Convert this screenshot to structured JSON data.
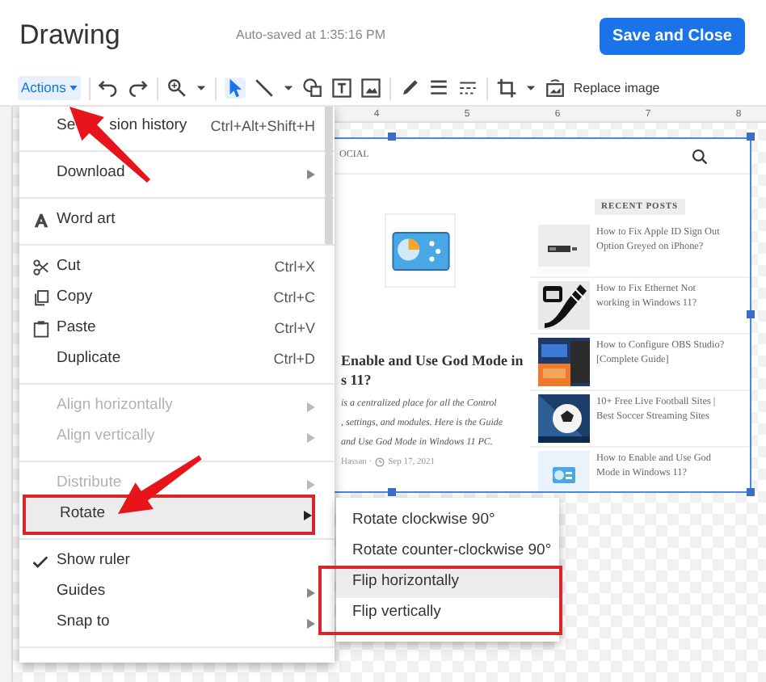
{
  "header": {
    "title": "Drawing",
    "autosave": "Auto-saved at 1:35:16 PM",
    "save_button": "Save and Close"
  },
  "toolbar": {
    "actions": "Actions",
    "replace_image": "Replace image"
  },
  "ruler": {
    "numbers": [
      "4",
      "5",
      "6",
      "7",
      "8"
    ]
  },
  "menu": {
    "groups": [
      [
        {
          "label": "Se",
          "label_after_arrow": "sion history",
          "shortcut": "Ctrl+Alt+Shift+H",
          "submenu": false,
          "disabled": false,
          "selected": false,
          "checked": false
        }
      ],
      [
        {
          "label": "Download",
          "submenu": true,
          "disabled": false,
          "selected": false,
          "checked": false
        }
      ],
      [
        {
          "label": "Word art",
          "submenu": false,
          "disabled": false,
          "selected": false,
          "checked": false
        }
      ],
      [
        {
          "label": "Cut",
          "shortcut": "Ctrl+X",
          "submenu": false,
          "disabled": false,
          "selected": false,
          "checked": false
        },
        {
          "label": "Copy",
          "shortcut": "Ctrl+C",
          "submenu": false,
          "disabled": false,
          "selected": false,
          "checked": false
        },
        {
          "label": "Paste",
          "shortcut": "Ctrl+V",
          "submenu": false,
          "disabled": false,
          "selected": false,
          "checked": false
        },
        {
          "label": "Duplicate",
          "shortcut": "Ctrl+D",
          "submenu": false,
          "disabled": false,
          "selected": false,
          "checked": false
        }
      ],
      [
        {
          "label": "Align horizontally",
          "submenu": true,
          "disabled": true,
          "selected": false,
          "checked": false
        },
        {
          "label": "Align vertically",
          "submenu": true,
          "disabled": true,
          "selected": false,
          "checked": false
        }
      ],
      [
        {
          "label": "Distribute",
          "submenu": true,
          "disabled": true,
          "selected": false,
          "checked": false
        },
        {
          "label": "Rotate",
          "submenu": true,
          "disabled": false,
          "selected": true,
          "checked": false
        }
      ],
      [
        {
          "label": "Show ruler",
          "submenu": false,
          "disabled": false,
          "selected": false,
          "checked": true
        },
        {
          "label": "Guides",
          "submenu": true,
          "disabled": false,
          "selected": false,
          "checked": false
        },
        {
          "label": "Snap to",
          "submenu": true,
          "disabled": false,
          "selected": false,
          "checked": false
        }
      ]
    ]
  },
  "submenu": {
    "items": [
      {
        "label": "Rotate clockwise 90°",
        "selected": false
      },
      {
        "label": "Rotate counter-clockwise 90°",
        "selected": false
      },
      {
        "label": "Flip horizontally",
        "selected": true
      },
      {
        "label": "Flip vertically",
        "selected": false
      }
    ]
  },
  "preview": {
    "nav": "OCIAL",
    "article": {
      "title_lines": [
        "Enable and Use God Mode in",
        "s 11?"
      ],
      "description_lines": [
        "is a centralized place for all the Control",
        ", settings, and modules. Here is the Guide",
        "and Use God Mode in Windows 11 PC."
      ],
      "author": "Hassan ·",
      "date": "Sep 17, 2021"
    },
    "recent_heading": "RECENT POSTS",
    "posts": [
      {
        "title": "How to Fix Apple ID Sign Out Option Greyed on iPhone?"
      },
      {
        "title": "How to Fix Ethernet Not working in Windows 11?"
      },
      {
        "title": "How to Configure OBS Studio? [Complete Guide]"
      },
      {
        "title": "10+ Free Live Football Sites | Best Soccer Streaming Sites"
      },
      {
        "title": "How to Enable and Use God Mode in Windows 11?"
      }
    ]
  }
}
